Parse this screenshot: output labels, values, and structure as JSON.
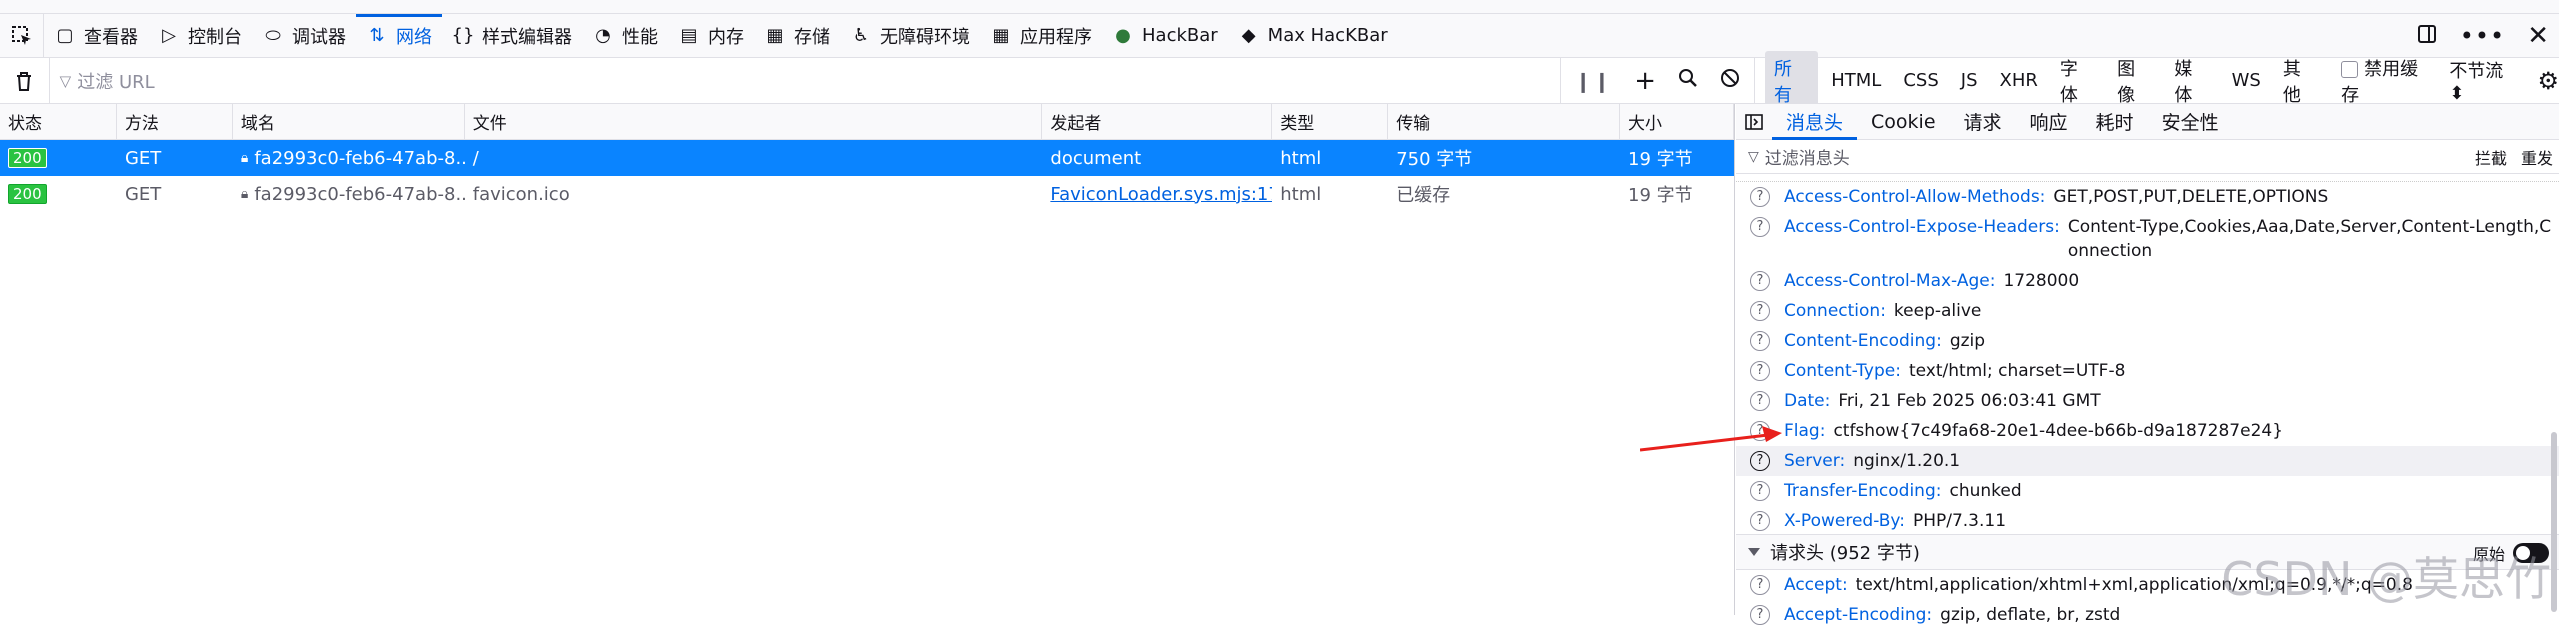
{
  "toolbar": {
    "tabs": [
      {
        "label": "查看器",
        "icon": "inspector-icon"
      },
      {
        "label": "控制台",
        "icon": "console-icon"
      },
      {
        "label": "调试器",
        "icon": "debugger-icon"
      },
      {
        "label": "网络",
        "icon": "network-icon",
        "active": true
      },
      {
        "label": "样式编辑器",
        "icon": "style-editor-icon"
      },
      {
        "label": "性能",
        "icon": "performance-icon"
      },
      {
        "label": "内存",
        "icon": "memory-icon"
      },
      {
        "label": "存储",
        "icon": "storage-icon"
      },
      {
        "label": "无障碍环境",
        "icon": "accessibility-icon"
      },
      {
        "label": "应用程序",
        "icon": "application-icon"
      },
      {
        "label": "HackBar",
        "icon": "hackbar-icon"
      },
      {
        "label": "Max HacKBar",
        "icon": "max-hackbar-icon"
      }
    ]
  },
  "filterbar": {
    "placeholder": "过滤 URL",
    "types": [
      "所有",
      "HTML",
      "CSS",
      "JS",
      "XHR",
      "字体",
      "图像",
      "媒体",
      "WS",
      "其他"
    ],
    "disable_cache": "禁用缓存",
    "throttle": "不节流 ⬍"
  },
  "table": {
    "headers": [
      "状态",
      "方法",
      "域名",
      "文件",
      "发起者",
      "类型",
      "传输",
      "大小"
    ],
    "rows": [
      {
        "status": "200",
        "method": "GET",
        "domain": "fa2993c0-feb6-47ab-8...",
        "file": "/",
        "initiator": "document",
        "type": "html",
        "transfer": "750 字节",
        "size": "19 字节"
      },
      {
        "status": "200",
        "method": "GET",
        "domain": "fa2993c0-feb6-47ab-8...",
        "file": "favicon.ico",
        "initiator": "FaviconLoader.sys.mjs:17...",
        "type": "html",
        "transfer": "已缓存",
        "size": "19 字节"
      }
    ]
  },
  "side": {
    "tabs": [
      "消息头",
      "Cookie",
      "请求",
      "响应",
      "耗时",
      "安全性"
    ],
    "filter_placeholder": "过滤消息头",
    "block": "拦截",
    "resend": "重发",
    "response_headers": [
      {
        "name": "Access-Control-Allow-Methods:",
        "value": "GET,POST,PUT,DELETE,OPTIONS"
      },
      {
        "name": "Access-Control-Expose-Headers:",
        "value": "Content-Type,Cookies,Aaa,Date,Server,Content-Length,Connection"
      },
      {
        "name": "Access-Control-Max-Age:",
        "value": "1728000"
      },
      {
        "name": "Connection:",
        "value": "keep-alive"
      },
      {
        "name": "Content-Encoding:",
        "value": "gzip"
      },
      {
        "name": "Content-Type:",
        "value": "text/html; charset=UTF-8"
      },
      {
        "name": "Date:",
        "value": "Fri, 21 Feb 2025 06:03:41 GMT"
      },
      {
        "name": "Flag:",
        "value": "ctfshow{7c49fa68-20e1-4dee-b66b-d9a187287e24}"
      },
      {
        "name": "Server:",
        "value": "nginx/1.20.1"
      },
      {
        "name": "Transfer-Encoding:",
        "value": "chunked"
      },
      {
        "name": "X-Powered-By:",
        "value": "PHP/7.3.11"
      }
    ],
    "request_section": "请求头 (952 字节)",
    "raw_label": "原始",
    "request_headers": [
      {
        "name": "Accept:",
        "value": "text/html,application/xhtml+xml,application/xml;q=0.9,*/*;q=0.8"
      },
      {
        "name": "Accept-Encoding:",
        "value": "gzip, deflate, br, zstd"
      }
    ]
  },
  "watermark": "CSDN @莫思竹"
}
